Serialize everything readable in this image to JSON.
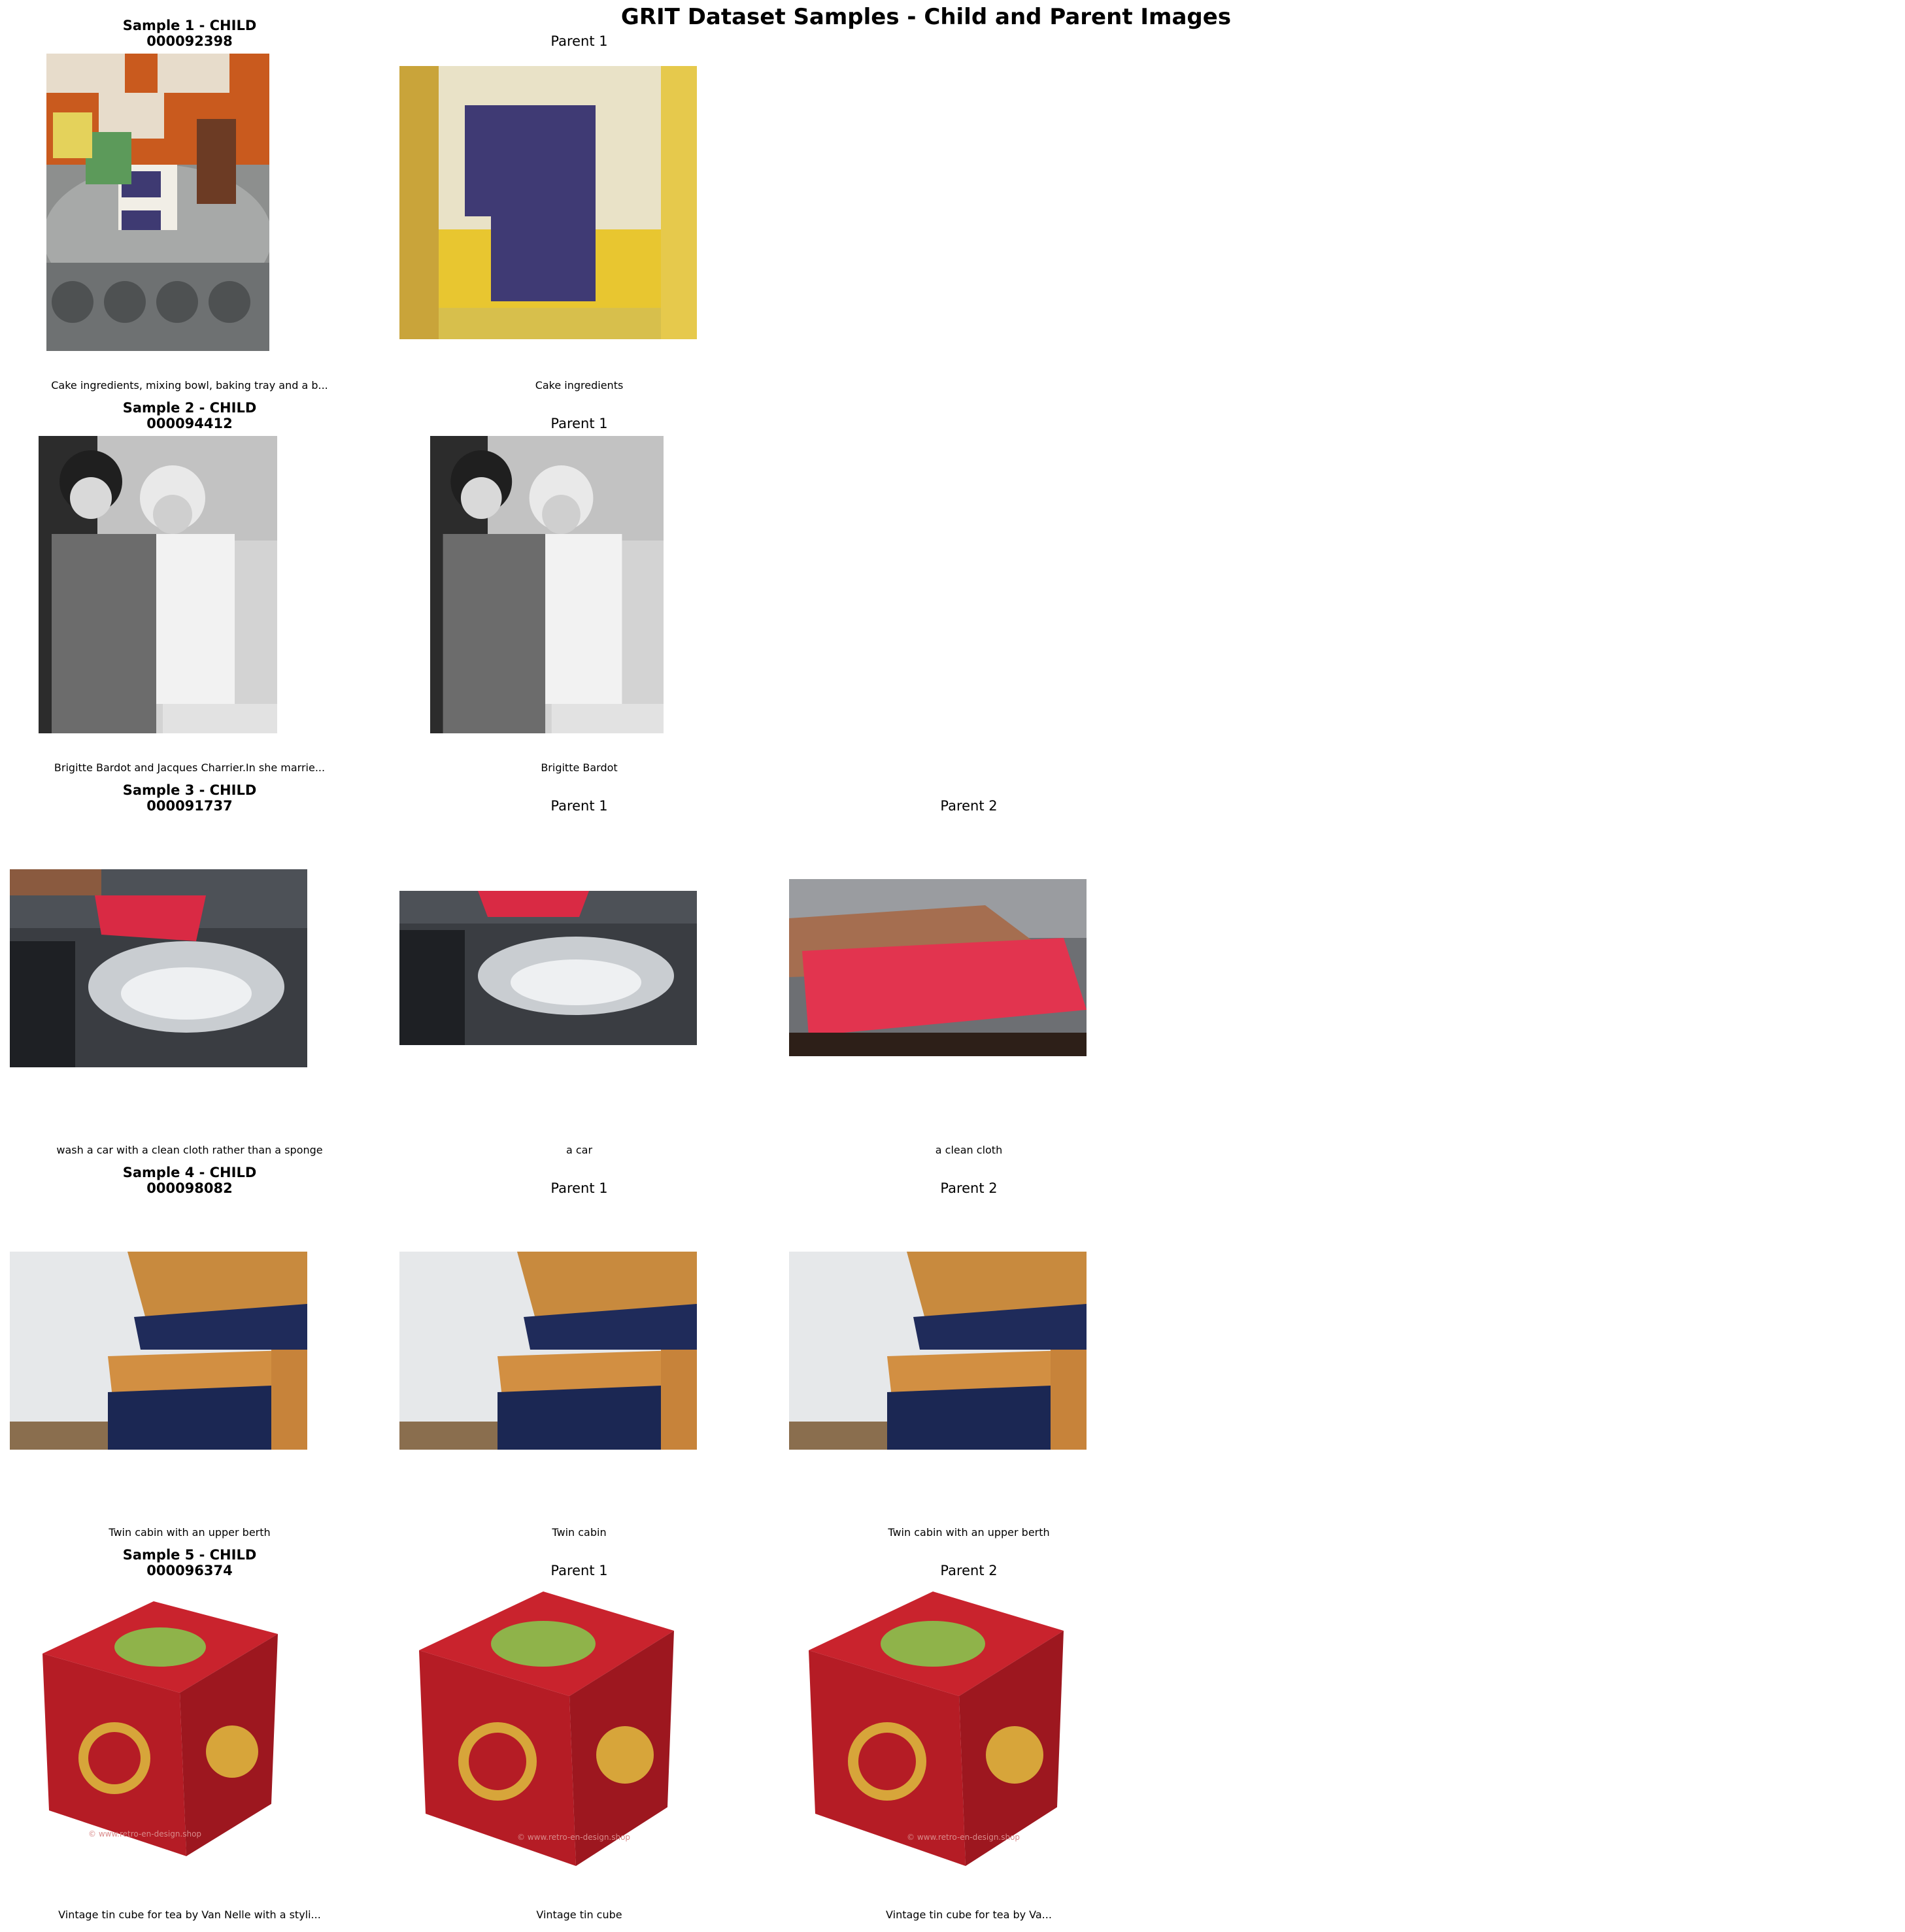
{
  "figure": {
    "title": "GRIT Dataset Samples - Child and Parent Images"
  },
  "samples": [
    {
      "child": {
        "title_line1": "Sample 1 - CHILD",
        "title_line2": "000092398",
        "caption": "Cake ingredients, mixing bowl, baking tray and a b..."
      },
      "parents": [
        {
          "title": "Parent 1",
          "caption": "Cake ingredients"
        }
      ]
    },
    {
      "child": {
        "title_line1": "Sample 2 - CHILD",
        "title_line2": "000094412",
        "caption": "Brigitte Bardot and Jacques Charrier.In she marrie..."
      },
      "parents": [
        {
          "title": "Parent 1",
          "caption": "Brigitte Bardot"
        }
      ]
    },
    {
      "child": {
        "title_line1": "Sample 3 - CHILD",
        "title_line2": "000091737",
        "caption": "wash a car with a clean cloth rather than a sponge"
      },
      "parents": [
        {
          "title": "Parent 1",
          "caption": "a car"
        },
        {
          "title": "Parent 2",
          "caption": "a clean cloth"
        }
      ]
    },
    {
      "child": {
        "title_line1": "Sample 4 - CHILD",
        "title_line2": "000098082",
        "caption": "Twin cabin with an upper berth"
      },
      "parents": [
        {
          "title": "Parent 1",
          "caption": "Twin cabin"
        },
        {
          "title": "Parent 2",
          "caption": "Twin cabin with an upper berth"
        }
      ]
    },
    {
      "child": {
        "title_line1": "Sample 5 - CHILD",
        "title_line2": "000096374",
        "caption": "Vintage tin cube for tea by Van Nelle with a styli..."
      },
      "parents": [
        {
          "title": "Parent 1",
          "caption": "Vintage tin cube"
        },
        {
          "title": "Parent 2",
          "caption": "Vintage tin cube for tea by Va..."
        }
      ]
    }
  ],
  "image_watermark": "© www.retro-en-design.shop"
}
